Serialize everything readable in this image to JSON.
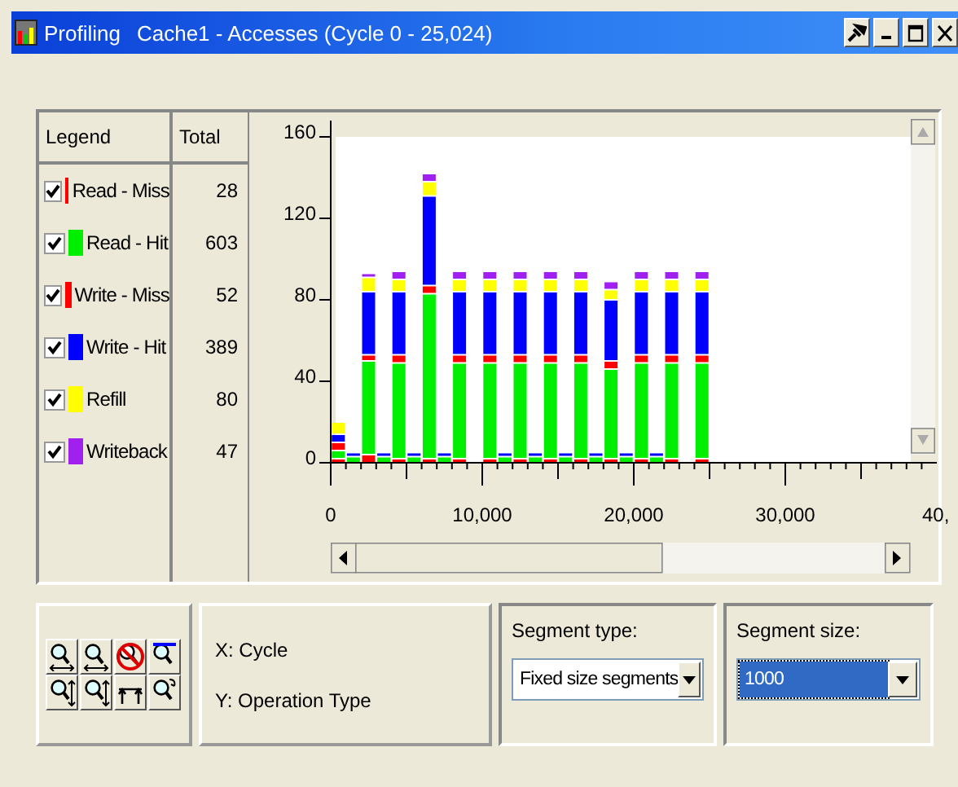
{
  "window": {
    "app_name": "Profiling",
    "title": "Cache1 - Accesses (Cycle 0 - 25,024)"
  },
  "legend": {
    "columns": [
      "Legend",
      "Total"
    ],
    "rows": [
      {
        "checked": true,
        "total": "28"
      },
      {
        "checked": true,
        "total": "603"
      },
      {
        "checked": true,
        "total": "52"
      },
      {
        "checked": true,
        "total": "389"
      },
      {
        "checked": true,
        "total": "80"
      },
      {
        "checked": true,
        "total": "47"
      }
    ]
  },
  "x_axis_cut_label": "40,",
  "chart_data": {
    "type": "bar",
    "stacked": true,
    "x": [
      500,
      1500,
      2500,
      3500,
      4500,
      5500,
      6500,
      7500,
      8500,
      9500,
      10500,
      11500,
      12500,
      13500,
      14500,
      15500,
      16500,
      17500,
      18500,
      19500,
      20500,
      21500,
      22500,
      23500,
      24500
    ],
    "xlim": [
      0,
      40000
    ],
    "ylim": [
      0,
      160
    ],
    "xticks": [
      {
        "value": 0,
        "label": "0"
      },
      {
        "value": 10000,
        "label": "10,000"
      },
      {
        "value": 20000,
        "label": "20,000"
      },
      {
        "value": 30000,
        "label": "30,000"
      }
    ],
    "yticks": [
      0,
      40,
      80,
      120,
      160
    ],
    "series": [
      {
        "name": "Read - Miss",
        "color": "#ff0000",
        "values": [
          2,
          0,
          4,
          0,
          2,
          0,
          2,
          0,
          2,
          0,
          2,
          0,
          2,
          0,
          2,
          0,
          2,
          0,
          2,
          0,
          2,
          0,
          2,
          0,
          2
        ]
      },
      {
        "name": "Read - Hit",
        "color": "#00ee00",
        "values": [
          4,
          3,
          46,
          3,
          47,
          3,
          81,
          3,
          47,
          0,
          47,
          3,
          47,
          3,
          47,
          3,
          47,
          3,
          44,
          3,
          47,
          3,
          47,
          0,
          47
        ]
      },
      {
        "name": "Write - Miss",
        "color": "#ff0000",
        "values": [
          4,
          0,
          3,
          0,
          4,
          0,
          4,
          0,
          4,
          0,
          4,
          0,
          4,
          0,
          4,
          0,
          4,
          0,
          4,
          0,
          4,
          0,
          4,
          0,
          4
        ]
      },
      {
        "name": "Write - Hit",
        "color": "#0000ff",
        "values": [
          4,
          2,
          31,
          2,
          31,
          2,
          44,
          2,
          31,
          0,
          31,
          2,
          31,
          2,
          31,
          2,
          31,
          2,
          30,
          2,
          31,
          2,
          31,
          0,
          31
        ]
      },
      {
        "name": "Refill",
        "color": "#ffff00",
        "values": [
          6,
          0,
          7,
          0,
          6,
          0,
          7,
          0,
          6,
          0,
          6,
          0,
          6,
          0,
          6,
          0,
          6,
          0,
          5,
          0,
          6,
          0,
          6,
          0,
          6
        ]
      },
      {
        "name": "Writeback",
        "color": "#a020f0",
        "values": [
          0,
          0,
          2,
          0,
          4,
          0,
          4,
          0,
          4,
          0,
          4,
          0,
          4,
          0,
          4,
          0,
          4,
          0,
          4,
          0,
          4,
          0,
          4,
          0,
          4
        ]
      }
    ]
  },
  "axes_info": {
    "x": "X: Cycle",
    "y": "Y: Operation Type"
  },
  "segment_type": {
    "label": "Segment type:",
    "value": "Fixed size segments",
    "focused": false
  },
  "segment_size": {
    "label": "Segment size:",
    "value": "1000",
    "focused": true
  }
}
